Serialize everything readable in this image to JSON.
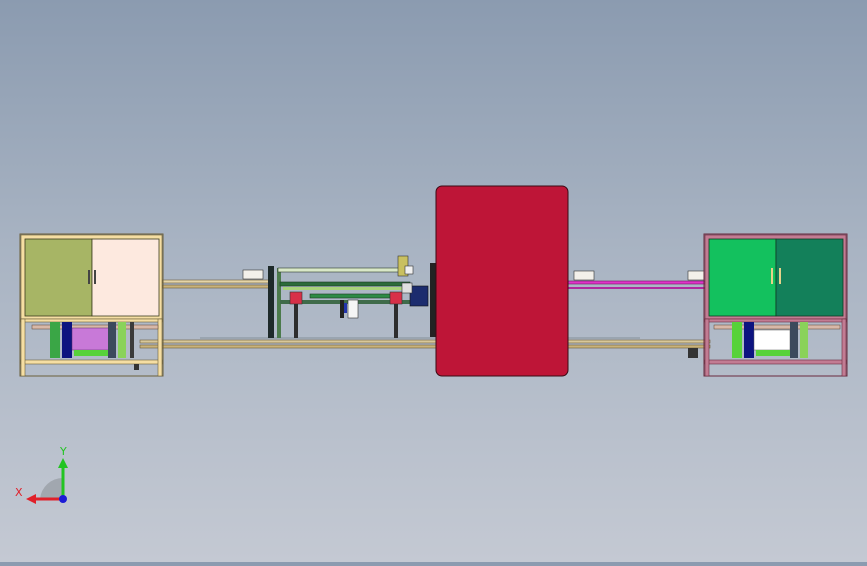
{
  "viewport": {
    "background_top": "#8b9bb0",
    "background_bottom": "#c4c9d3"
  },
  "machine": {
    "left_cabinet": {
      "door_left_color": "#a7b565",
      "door_right_color": "#fde9df",
      "frame_color": "#f5dea3"
    },
    "right_cabinet": {
      "door_left_color": "#13c15e",
      "door_right_color": "#13805a",
      "frame_color": "#c27c93"
    },
    "center_housing_color": "#be1537",
    "rail_color": "#c9b27a",
    "right_rail_color": "#e033c8",
    "gantry_color": "#2c6b3a"
  },
  "triad": {
    "x_label": "X",
    "y_label": "Y",
    "x_color": "#e0202a",
    "y_color": "#22c422",
    "z_color": "#1b1bd6"
  }
}
